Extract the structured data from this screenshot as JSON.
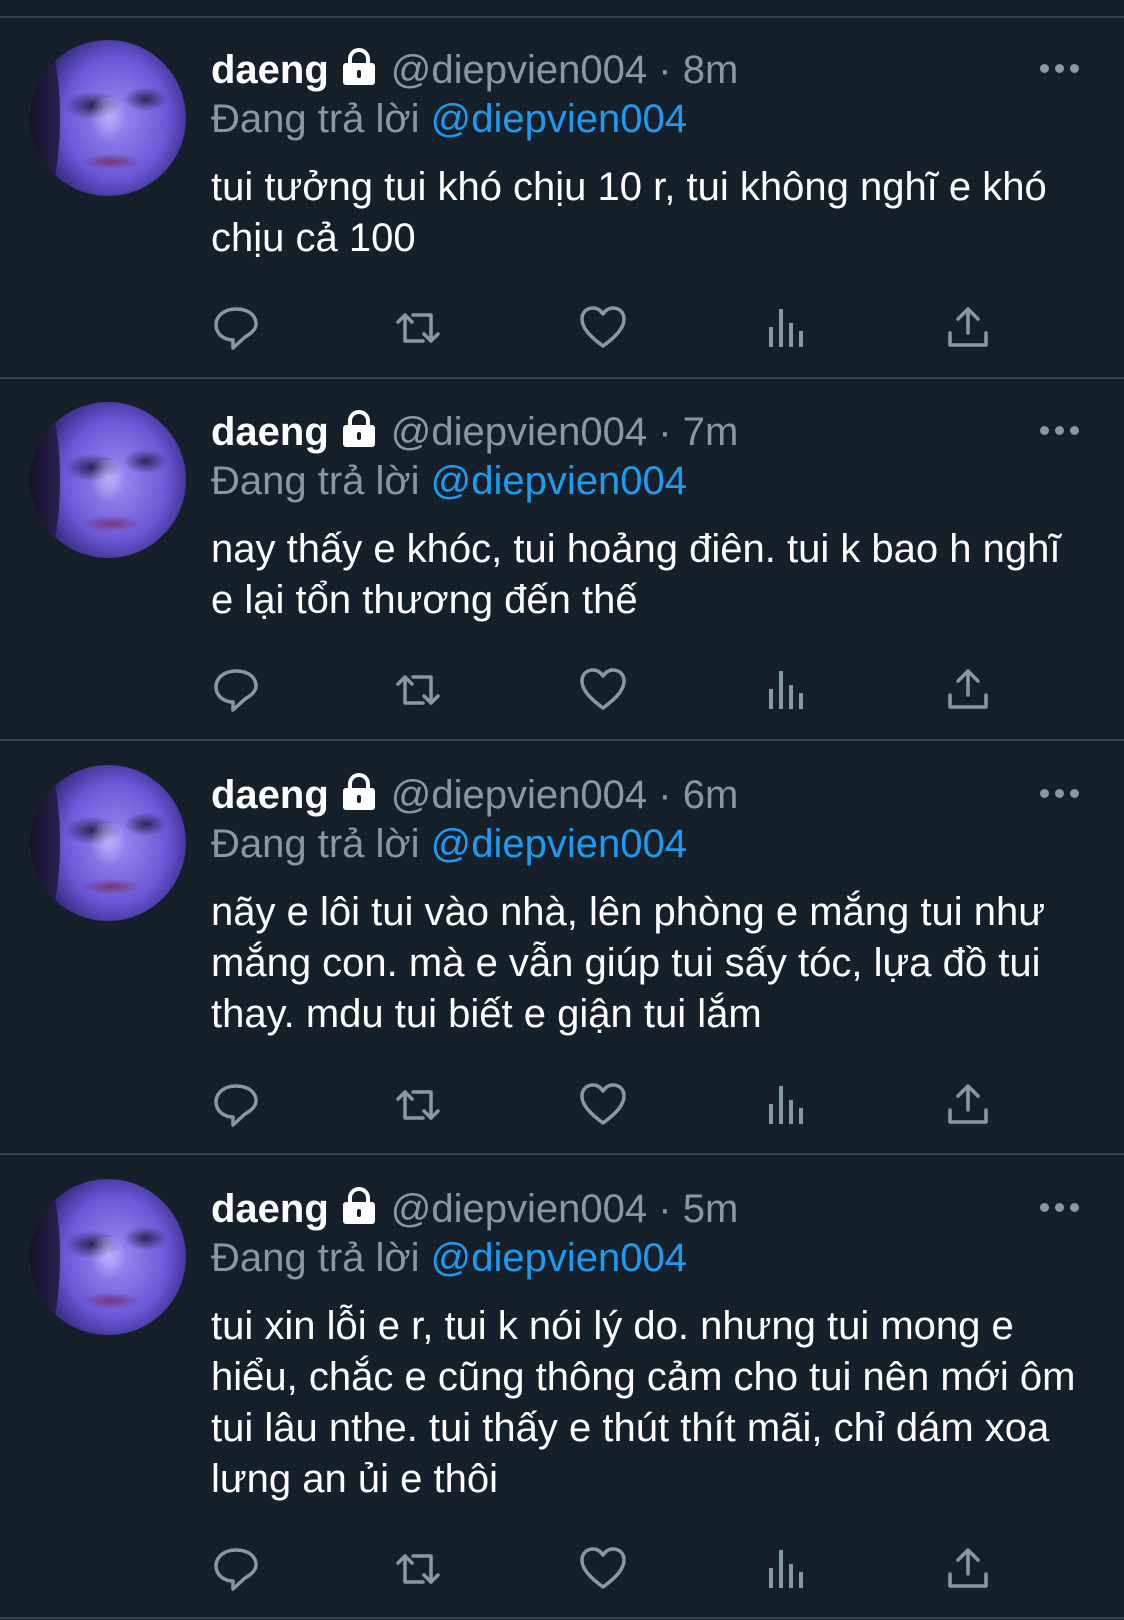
{
  "tweets": [
    {
      "name": "daeng",
      "handle": "@diepvien004",
      "dot": "·",
      "time": "8m",
      "reply_prefix": "Đang trả lời",
      "reply_to": "@diepvien004",
      "text": "tui tưởng tui khó chịu 10 r, tui không nghĩ e khó chịu cả 100"
    },
    {
      "name": "daeng",
      "handle": "@diepvien004",
      "dot": "·",
      "time": "7m",
      "reply_prefix": "Đang trả lời",
      "reply_to": "@diepvien004",
      "text": "nay thấy e khóc, tui hoảng điên. tui k bao h nghĩ e lại tổn thương đến thế"
    },
    {
      "name": "daeng",
      "handle": "@diepvien004",
      "dot": "·",
      "time": "6m",
      "reply_prefix": "Đang trả lời",
      "reply_to": "@diepvien004",
      "text": "nãy e lôi tui vào nhà, lên phòng e mắng tui như mắng con. mà e vẫn giúp tui sấy tóc, lựa đồ tui thay. mdu tui biết e giận tui lắm"
    },
    {
      "name": "daeng",
      "handle": "@diepvien004",
      "dot": "·",
      "time": "5m",
      "reply_prefix": "Đang trả lời",
      "reply_to": "@diepvien004",
      "text": "tui xin lỗi e r, tui k nói lý do. nhưng tui mong e hiểu, chắc e cũng thông cảm cho tui nên mới ôm tui lâu nthe. tui thấy e thút thít mãi, chỉ dám xoa lưng an ủi e thôi"
    }
  ],
  "icons": {
    "reply": "reply-icon",
    "retweet": "retweet-icon",
    "like": "heart-icon",
    "analytics": "analytics-icon",
    "share": "share-icon",
    "lock": "lock-icon",
    "more": "more-icon"
  },
  "colors": {
    "background": "#15202b",
    "divider": "#38444d",
    "muted": "#8899a6",
    "mention": "#1d9bf0",
    "text": "#ffffff"
  }
}
